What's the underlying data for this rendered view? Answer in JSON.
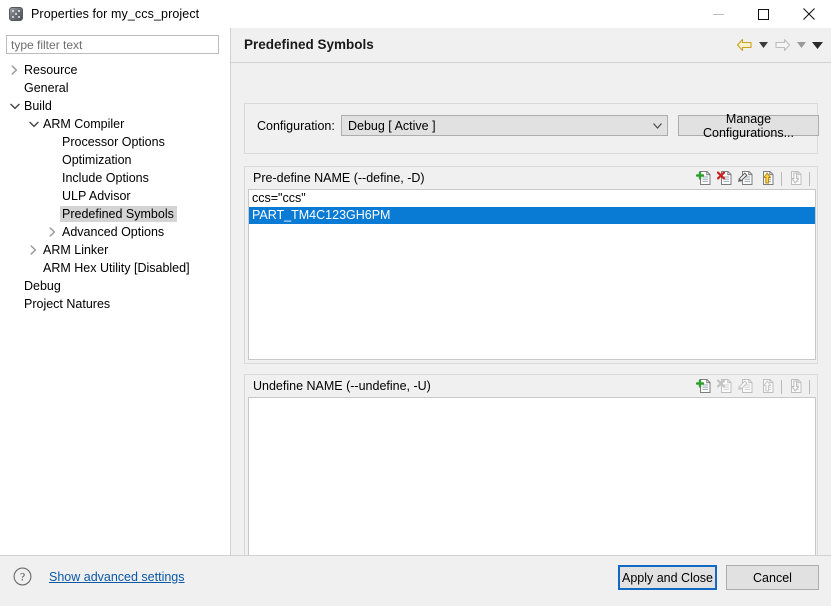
{
  "window": {
    "title": "Properties for my_ccs_project",
    "icon": "cube-icon",
    "controls": {
      "minimize": "minimize-button",
      "maximize": "maximize-button",
      "close": "close-button"
    }
  },
  "sidebar": {
    "filter": {
      "placeholder": "type filter text",
      "value": ""
    },
    "items": [
      {
        "label": "Resource",
        "depth": 0,
        "twisty": "collapsed",
        "selected": false
      },
      {
        "label": "General",
        "depth": 0,
        "twisty": "none",
        "selected": false
      },
      {
        "label": "Build",
        "depth": 0,
        "twisty": "expanded",
        "selected": false
      },
      {
        "label": "ARM Compiler",
        "depth": 1,
        "twisty": "expanded",
        "selected": false
      },
      {
        "label": "Processor Options",
        "depth": 2,
        "twisty": "none",
        "selected": false
      },
      {
        "label": "Optimization",
        "depth": 2,
        "twisty": "none",
        "selected": false
      },
      {
        "label": "Include Options",
        "depth": 2,
        "twisty": "none",
        "selected": false
      },
      {
        "label": "ULP Advisor",
        "depth": 2,
        "twisty": "none",
        "selected": false
      },
      {
        "label": "Predefined Symbols",
        "depth": 2,
        "twisty": "none",
        "selected": true
      },
      {
        "label": "Advanced Options",
        "depth": 2,
        "twisty": "collapsed",
        "selected": false
      },
      {
        "label": "ARM Linker",
        "depth": 1,
        "twisty": "collapsed",
        "selected": false
      },
      {
        "label": "ARM Hex Utility  [Disabled]",
        "depth": 1,
        "twisty": "none",
        "selected": false
      },
      {
        "label": "Debug",
        "depth": 0,
        "twisty": "none",
        "selected": false
      },
      {
        "label": "Project Natures",
        "depth": 0,
        "twisty": "none",
        "selected": false
      }
    ]
  },
  "page": {
    "title": "Predefined Symbols",
    "nav": {
      "back": "back-arrow-icon",
      "back_menu": "back-dropdown-icon",
      "forward": "forward-arrow-icon",
      "forward_menu": "forward-dropdown-icon",
      "view_menu": "view-menu-icon"
    }
  },
  "configuration": {
    "label": "Configuration:",
    "selected": "Debug  [ Active ]",
    "options": [
      "Debug  [ Active ]"
    ],
    "manage_button": "Manage Configurations..."
  },
  "predefine": {
    "header": "Pre-define NAME (--define, -D)",
    "items": [
      {
        "text": "ccs=\"ccs\"",
        "selected": false
      },
      {
        "text": "PART_TM4C123GH6PM",
        "selected": true
      }
    ],
    "tools": [
      {
        "name": "add-icon",
        "enabled": true
      },
      {
        "name": "delete-icon",
        "enabled": true
      },
      {
        "name": "edit-icon",
        "enabled": true
      },
      {
        "name": "move-up-icon",
        "enabled": true
      },
      {
        "name": "move-down-icon",
        "enabled": false
      }
    ]
  },
  "undefine": {
    "header": "Undefine NAME (--undefine, -U)",
    "items": [],
    "tools": [
      {
        "name": "add-icon",
        "enabled": true
      },
      {
        "name": "delete-icon",
        "enabled": false
      },
      {
        "name": "edit-icon",
        "enabled": false
      },
      {
        "name": "move-up-icon",
        "enabled": false
      },
      {
        "name": "move-down-icon",
        "enabled": false
      }
    ]
  },
  "footer": {
    "help_icon": "help-icon",
    "advanced_link": "Show advanced settings",
    "apply_button": "Apply and Close",
    "cancel_button": "Cancel"
  },
  "colors": {
    "selection_blue": "#0a7bd5",
    "link_blue": "#0b58a6",
    "focus_blue": "#1169c4",
    "chrome_gray": "#f0f0f0",
    "tree_selected_gray": "#d4d4d4"
  }
}
